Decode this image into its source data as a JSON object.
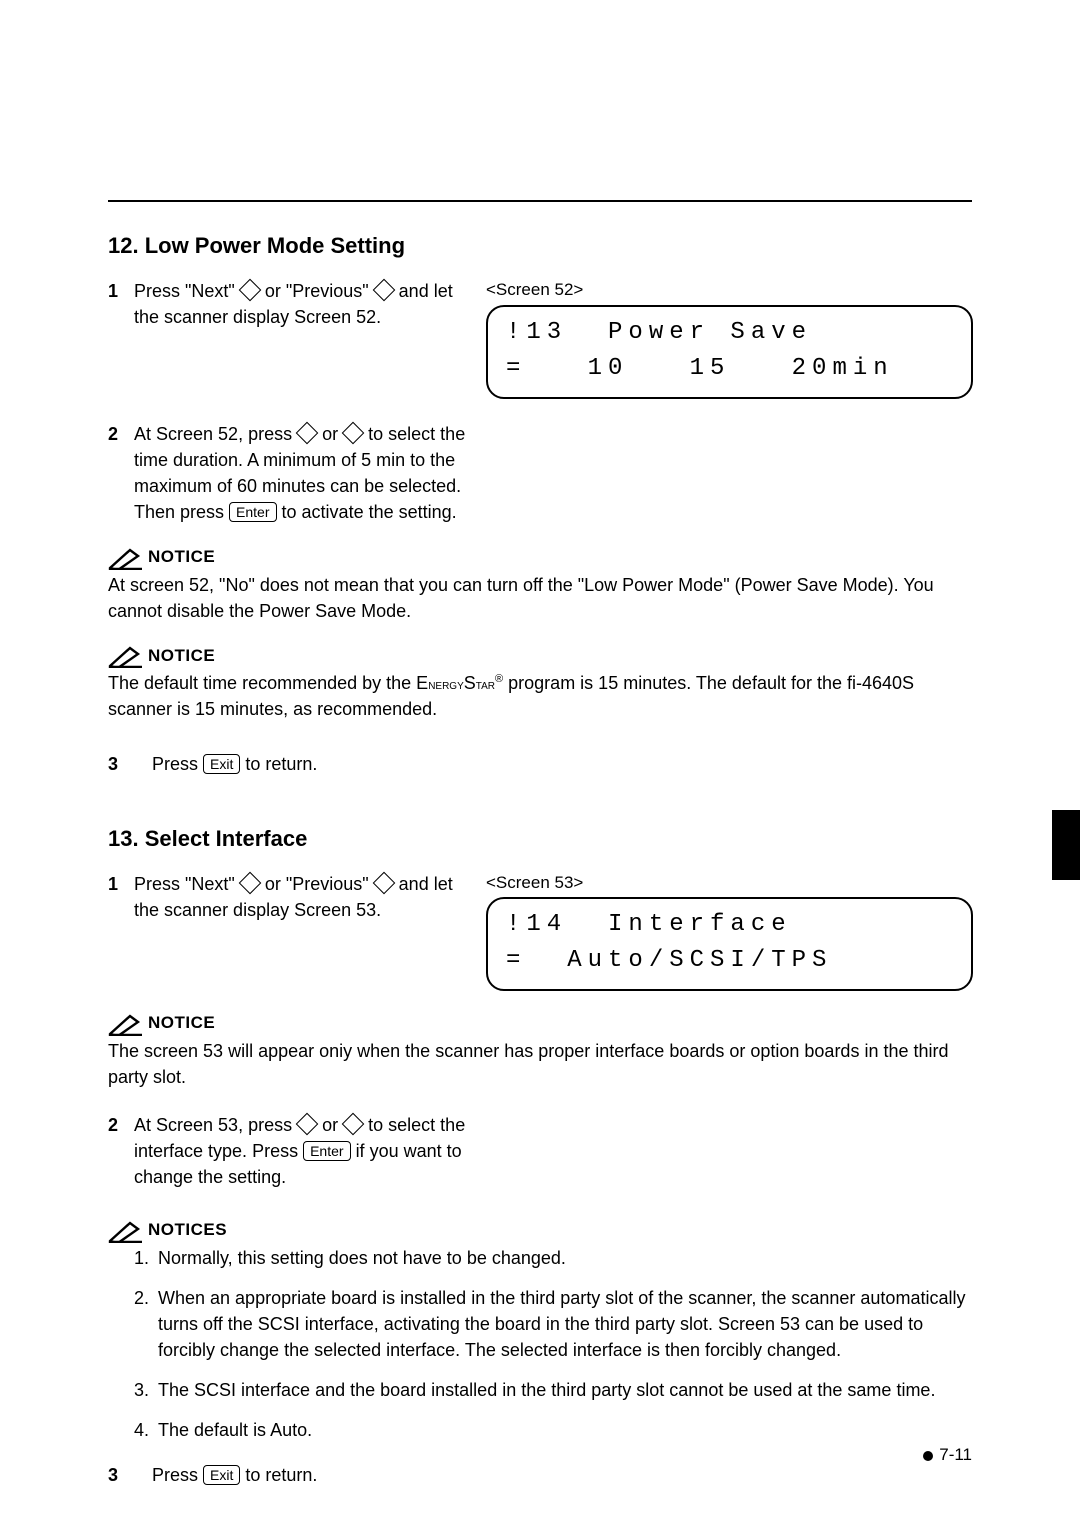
{
  "section12": {
    "heading": "12.  Low Power Mode Setting",
    "step1_pre": "Press \"Next\" ",
    "step1_mid": " or \"Previous\" ",
    "step1_post": " and let the scanner display Screen 52.",
    "screen_label": "<Screen 52>",
    "lcd_line1": "!13  Power Save",
    "lcd_line2": "=   10   15   20min",
    "step2_a": "At Screen 52, press  ",
    "step2_b": " or ",
    "step2_c": " to select the time duration. A minimum of 5 min to the maximum of 60 minutes can be selected. Then press ",
    "step2_d": " to activate the setting.",
    "enter": "Enter",
    "notice1_label": "NOTICE",
    "notice1_text": "At screen 52, \"No\" does not mean that you can turn off the \"Low Power Mode\" (Power Save Mode).  You cannot disable the Power Save Mode.",
    "notice2_label": "NOTICE",
    "notice2_a": "The default time recommended by the ",
    "notice2_brand1": "E",
    "notice2_brand2": "nergy",
    "notice2_brand3": "S",
    "notice2_brand4": "tar",
    "notice2_b": " program is 15 minutes.  The default for the fi-4640S scanner is 15 minutes, as recommended.",
    "step3_a": "Press ",
    "step3_b": " to return.",
    "exit": "Exit"
  },
  "section13": {
    "heading": "13.  Select Interface",
    "step1_pre": "Press \"Next\" ",
    "step1_mid": " or \"Previous\" ",
    "step1_post": " and let the scanner display Screen 53.",
    "screen_label": "<Screen 53>",
    "lcd_line1": "!14  Interface",
    "lcd_line2": "=  Auto/SCSI/TPS",
    "notice1_label": "NOTICE",
    "notice1_text": "The screen 53 will appear oniy when the scanner has proper interface boards or option boards in the third party slot.",
    "step2_a": "At Screen 53, press ",
    "step2_b": " or ",
    "step2_c": " to select the interface type. Press ",
    "step2_d": " if you want to change the setting.",
    "enter": "Enter",
    "notices_label": "NOTICES",
    "notices": [
      "Normally, this setting does not have to be changed.",
      "When an appropriate board is installed in the third party slot of the scanner, the scanner automatically turns off the SCSI interface, activating the board in the third party slot.  Screen 53 can be used to forcibly change the selected interface. The selected interface is then forcibly changed.",
      "The SCSI interface and the board installed in the third party slot cannot be used at the same time.",
      "The default is Auto."
    ],
    "step3_a": "Press ",
    "step3_b": " to return.",
    "exit": "Exit"
  },
  "page_number": "7-11"
}
